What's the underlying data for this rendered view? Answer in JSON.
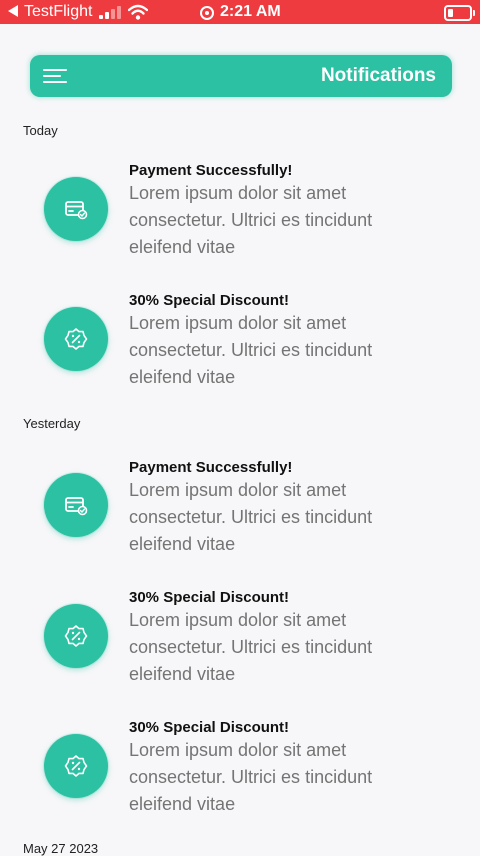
{
  "status_bar": {
    "app": "TestFlight",
    "time": "2:21 AM",
    "background": "#ee3b3f"
  },
  "header": {
    "title": "Notifications",
    "accent": "#2bc1a2",
    "menu_icon": "hamburger-menu-icon"
  },
  "sections": [
    {
      "label": "Today"
    },
    {
      "label": "Yesterday"
    }
  ],
  "notifications": [
    {
      "icon": "card-check-icon",
      "title": "Payment Successfully!",
      "body": "Lorem ipsum dolor sit amet consectetur. Ultrici es tincidunt eleifend vitae"
    },
    {
      "icon": "discount-badge-icon",
      "title": "30% Special Discount!",
      "body": "Lorem ipsum dolor sit amet consectetur. Ultrici es tincidunt eleifend vitae"
    },
    {
      "icon": "card-check-icon",
      "title": "Payment Successfully!",
      "body": "Lorem ipsum dolor sit amet consectetur. Ultrici es tincidunt eleifend vitae"
    },
    {
      "icon": "discount-badge-icon",
      "title": "30% Special Discount!",
      "body": "Lorem ipsum dolor sit amet consectetur. Ultrici es tincidunt eleifend vitae"
    },
    {
      "icon": "discount-badge-icon",
      "title": "30% Special Discount!",
      "body": "Lorem ipsum dolor sit amet consectetur. Ultrici es tincidunt eleifend vitae"
    }
  ],
  "next_section_partial": "May 27 2023"
}
